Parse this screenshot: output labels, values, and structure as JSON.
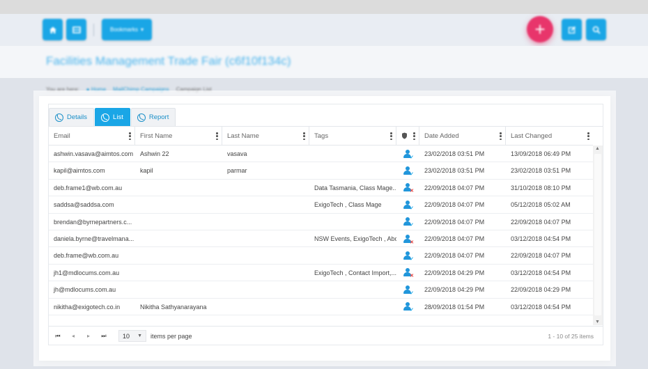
{
  "header": {
    "home_icon": "home-icon",
    "menu_icon": "grid-icon",
    "bookmarks_label": "Bookmarks",
    "bookmarks_caret": "▾",
    "add_glyph": "+",
    "edit_icon": "edit-icon",
    "search_icon": "search-icon"
  },
  "page": {
    "title": "Facilities Management Trade Fair (c6f10f134c)"
  },
  "breadcrumb": {
    "prefix": "You are here:",
    "home": "Home",
    "section": "MailChimp Campaigns",
    "current": "Campaign List"
  },
  "tabs": [
    {
      "label": "Details",
      "active": false
    },
    {
      "label": "List",
      "active": true
    },
    {
      "label": "Report",
      "active": false
    }
  ],
  "grid": {
    "columns": [
      "Email",
      "First Name",
      "Last Name",
      "Tags",
      "",
      "Date Added",
      "Last Changed"
    ],
    "subscribed_column_icon": "shield-icon",
    "rows": [
      {
        "email": "ashwin.vasava@aimtos.com",
        "first": "Ashwin 22",
        "last": "vasava",
        "tags": "",
        "status": "subscribed",
        "added": "23/02/2018 03:51 PM",
        "changed": "13/09/2018 06:49 PM"
      },
      {
        "email": "kapil@aimtos.com",
        "first": "kapil",
        "last": "parmar",
        "tags": "",
        "status": "subscribed",
        "added": "23/02/2018 03:51 PM",
        "changed": "23/02/2018 03:51 PM"
      },
      {
        "email": "deb.frame1@wb.com.au",
        "first": "",
        "last": "",
        "tags": "Data Tasmania, Class Mage...",
        "status": "unsubscribed",
        "added": "22/09/2018 04:07 PM",
        "changed": "31/10/2018 08:10 PM"
      },
      {
        "email": "saddsa@saddsa.com",
        "first": "",
        "last": "",
        "tags": "ExigoTech , Class Mage",
        "status": "subscribed",
        "added": "22/09/2018 04:07 PM",
        "changed": "05/12/2018 05:02 AM"
      },
      {
        "email": "brendan@byrnepartners.c...",
        "first": "",
        "last": "",
        "tags": "",
        "status": "subscribed",
        "added": "22/09/2018 04:07 PM",
        "changed": "22/09/2018 04:07 PM"
      },
      {
        "email": "daniela.byrne@travelmana...",
        "first": "",
        "last": "",
        "tags": "NSW Events, ExigoTech , Abc",
        "status": "unsubscribed",
        "added": "22/09/2018 04:07 PM",
        "changed": "03/12/2018 04:54 PM"
      },
      {
        "email": "deb.frame@wb.com.au",
        "first": "",
        "last": "",
        "tags": "",
        "status": "subscribed",
        "added": "22/09/2018 04:07 PM",
        "changed": "22/09/2018 04:07 PM"
      },
      {
        "email": "jh1@mdlocums.com.au",
        "first": "",
        "last": "",
        "tags": "ExigoTech , Contact Import,...",
        "status": "unsubscribed",
        "added": "22/09/2018 04:29 PM",
        "changed": "03/12/2018 04:54 PM"
      },
      {
        "email": "jh@mdlocums.com.au",
        "first": "",
        "last": "",
        "tags": "",
        "status": "subscribed",
        "added": "22/09/2018 04:29 PM",
        "changed": "22/09/2018 04:29 PM"
      },
      {
        "email": "nikitha@exigotech.co.in",
        "first": "Nikitha Sathyanarayana",
        "last": "",
        "tags": "",
        "status": "subscribed",
        "added": "28/09/2018 01:54 PM",
        "changed": "03/12/2018 04:54 PM"
      }
    ]
  },
  "pager": {
    "first_glyph": "⏮",
    "prev_glyph": "◂",
    "next_glyph": "▸",
    "last_glyph": "⏭",
    "page_size": "10",
    "page_size_label": "items per page",
    "info": "1 - 10 of 25 items"
  },
  "colors": {
    "accent": "#1aa6e6",
    "add_button": "#e8356b",
    "unsubscribed_mark": "#e53935"
  }
}
